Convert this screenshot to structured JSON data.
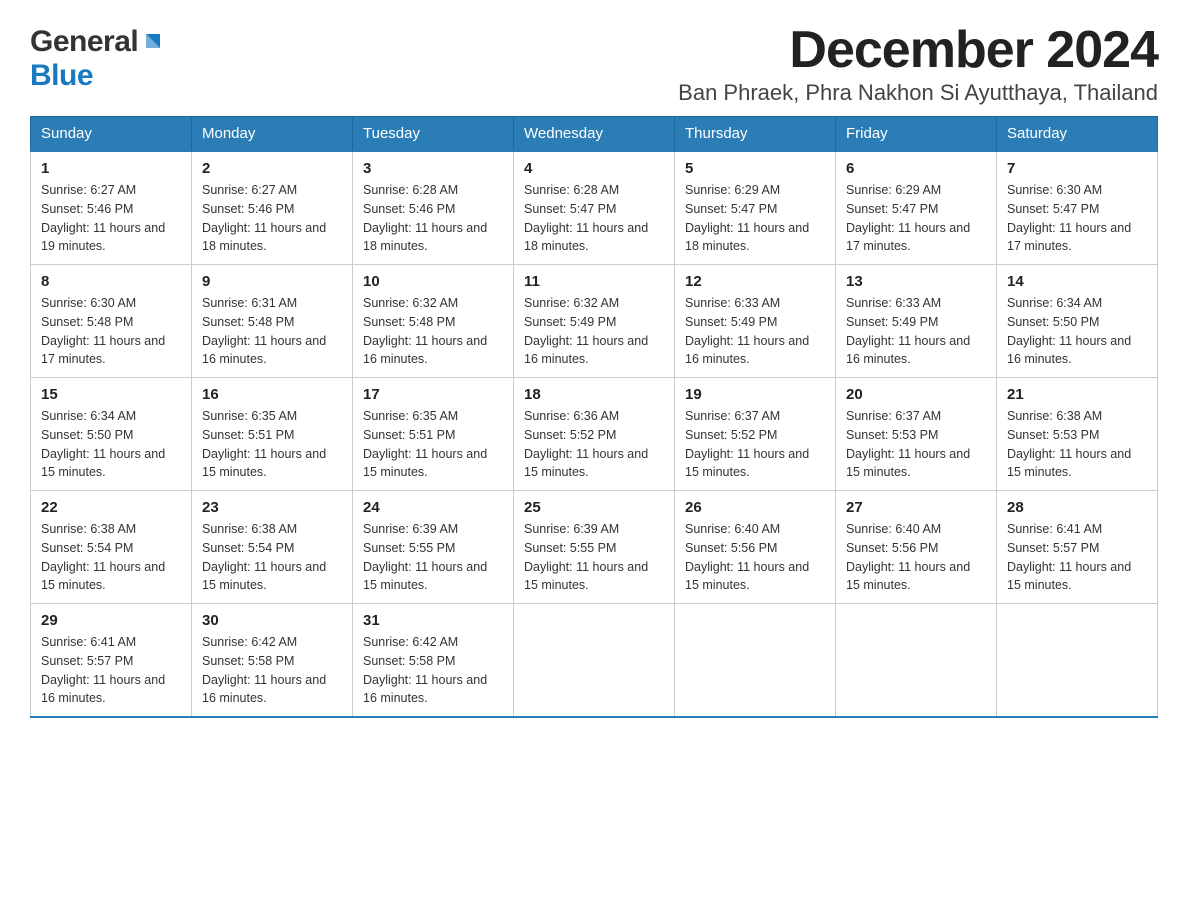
{
  "logo": {
    "general": "General",
    "blue": "Blue"
  },
  "title": "December 2024",
  "subtitle": "Ban Phraek, Phra Nakhon Si Ayutthaya, Thailand",
  "days_of_week": [
    "Sunday",
    "Monday",
    "Tuesday",
    "Wednesday",
    "Thursday",
    "Friday",
    "Saturday"
  ],
  "weeks": [
    [
      {
        "day": "1",
        "sunrise": "Sunrise: 6:27 AM",
        "sunset": "Sunset: 5:46 PM",
        "daylight": "Daylight: 11 hours and 19 minutes."
      },
      {
        "day": "2",
        "sunrise": "Sunrise: 6:27 AM",
        "sunset": "Sunset: 5:46 PM",
        "daylight": "Daylight: 11 hours and 18 minutes."
      },
      {
        "day": "3",
        "sunrise": "Sunrise: 6:28 AM",
        "sunset": "Sunset: 5:46 PM",
        "daylight": "Daylight: 11 hours and 18 minutes."
      },
      {
        "day": "4",
        "sunrise": "Sunrise: 6:28 AM",
        "sunset": "Sunset: 5:47 PM",
        "daylight": "Daylight: 11 hours and 18 minutes."
      },
      {
        "day": "5",
        "sunrise": "Sunrise: 6:29 AM",
        "sunset": "Sunset: 5:47 PM",
        "daylight": "Daylight: 11 hours and 18 minutes."
      },
      {
        "day": "6",
        "sunrise": "Sunrise: 6:29 AM",
        "sunset": "Sunset: 5:47 PM",
        "daylight": "Daylight: 11 hours and 17 minutes."
      },
      {
        "day": "7",
        "sunrise": "Sunrise: 6:30 AM",
        "sunset": "Sunset: 5:47 PM",
        "daylight": "Daylight: 11 hours and 17 minutes."
      }
    ],
    [
      {
        "day": "8",
        "sunrise": "Sunrise: 6:30 AM",
        "sunset": "Sunset: 5:48 PM",
        "daylight": "Daylight: 11 hours and 17 minutes."
      },
      {
        "day": "9",
        "sunrise": "Sunrise: 6:31 AM",
        "sunset": "Sunset: 5:48 PM",
        "daylight": "Daylight: 11 hours and 16 minutes."
      },
      {
        "day": "10",
        "sunrise": "Sunrise: 6:32 AM",
        "sunset": "Sunset: 5:48 PM",
        "daylight": "Daylight: 11 hours and 16 minutes."
      },
      {
        "day": "11",
        "sunrise": "Sunrise: 6:32 AM",
        "sunset": "Sunset: 5:49 PM",
        "daylight": "Daylight: 11 hours and 16 minutes."
      },
      {
        "day": "12",
        "sunrise": "Sunrise: 6:33 AM",
        "sunset": "Sunset: 5:49 PM",
        "daylight": "Daylight: 11 hours and 16 minutes."
      },
      {
        "day": "13",
        "sunrise": "Sunrise: 6:33 AM",
        "sunset": "Sunset: 5:49 PM",
        "daylight": "Daylight: 11 hours and 16 minutes."
      },
      {
        "day": "14",
        "sunrise": "Sunrise: 6:34 AM",
        "sunset": "Sunset: 5:50 PM",
        "daylight": "Daylight: 11 hours and 16 minutes."
      }
    ],
    [
      {
        "day": "15",
        "sunrise": "Sunrise: 6:34 AM",
        "sunset": "Sunset: 5:50 PM",
        "daylight": "Daylight: 11 hours and 15 minutes."
      },
      {
        "day": "16",
        "sunrise": "Sunrise: 6:35 AM",
        "sunset": "Sunset: 5:51 PM",
        "daylight": "Daylight: 11 hours and 15 minutes."
      },
      {
        "day": "17",
        "sunrise": "Sunrise: 6:35 AM",
        "sunset": "Sunset: 5:51 PM",
        "daylight": "Daylight: 11 hours and 15 minutes."
      },
      {
        "day": "18",
        "sunrise": "Sunrise: 6:36 AM",
        "sunset": "Sunset: 5:52 PM",
        "daylight": "Daylight: 11 hours and 15 minutes."
      },
      {
        "day": "19",
        "sunrise": "Sunrise: 6:37 AM",
        "sunset": "Sunset: 5:52 PM",
        "daylight": "Daylight: 11 hours and 15 minutes."
      },
      {
        "day": "20",
        "sunrise": "Sunrise: 6:37 AM",
        "sunset": "Sunset: 5:53 PM",
        "daylight": "Daylight: 11 hours and 15 minutes."
      },
      {
        "day": "21",
        "sunrise": "Sunrise: 6:38 AM",
        "sunset": "Sunset: 5:53 PM",
        "daylight": "Daylight: 11 hours and 15 minutes."
      }
    ],
    [
      {
        "day": "22",
        "sunrise": "Sunrise: 6:38 AM",
        "sunset": "Sunset: 5:54 PM",
        "daylight": "Daylight: 11 hours and 15 minutes."
      },
      {
        "day": "23",
        "sunrise": "Sunrise: 6:38 AM",
        "sunset": "Sunset: 5:54 PM",
        "daylight": "Daylight: 11 hours and 15 minutes."
      },
      {
        "day": "24",
        "sunrise": "Sunrise: 6:39 AM",
        "sunset": "Sunset: 5:55 PM",
        "daylight": "Daylight: 11 hours and 15 minutes."
      },
      {
        "day": "25",
        "sunrise": "Sunrise: 6:39 AM",
        "sunset": "Sunset: 5:55 PM",
        "daylight": "Daylight: 11 hours and 15 minutes."
      },
      {
        "day": "26",
        "sunrise": "Sunrise: 6:40 AM",
        "sunset": "Sunset: 5:56 PM",
        "daylight": "Daylight: 11 hours and 15 minutes."
      },
      {
        "day": "27",
        "sunrise": "Sunrise: 6:40 AM",
        "sunset": "Sunset: 5:56 PM",
        "daylight": "Daylight: 11 hours and 15 minutes."
      },
      {
        "day": "28",
        "sunrise": "Sunrise: 6:41 AM",
        "sunset": "Sunset: 5:57 PM",
        "daylight": "Daylight: 11 hours and 15 minutes."
      }
    ],
    [
      {
        "day": "29",
        "sunrise": "Sunrise: 6:41 AM",
        "sunset": "Sunset: 5:57 PM",
        "daylight": "Daylight: 11 hours and 16 minutes."
      },
      {
        "day": "30",
        "sunrise": "Sunrise: 6:42 AM",
        "sunset": "Sunset: 5:58 PM",
        "daylight": "Daylight: 11 hours and 16 minutes."
      },
      {
        "day": "31",
        "sunrise": "Sunrise: 6:42 AM",
        "sunset": "Sunset: 5:58 PM",
        "daylight": "Daylight: 11 hours and 16 minutes."
      },
      null,
      null,
      null,
      null
    ]
  ]
}
